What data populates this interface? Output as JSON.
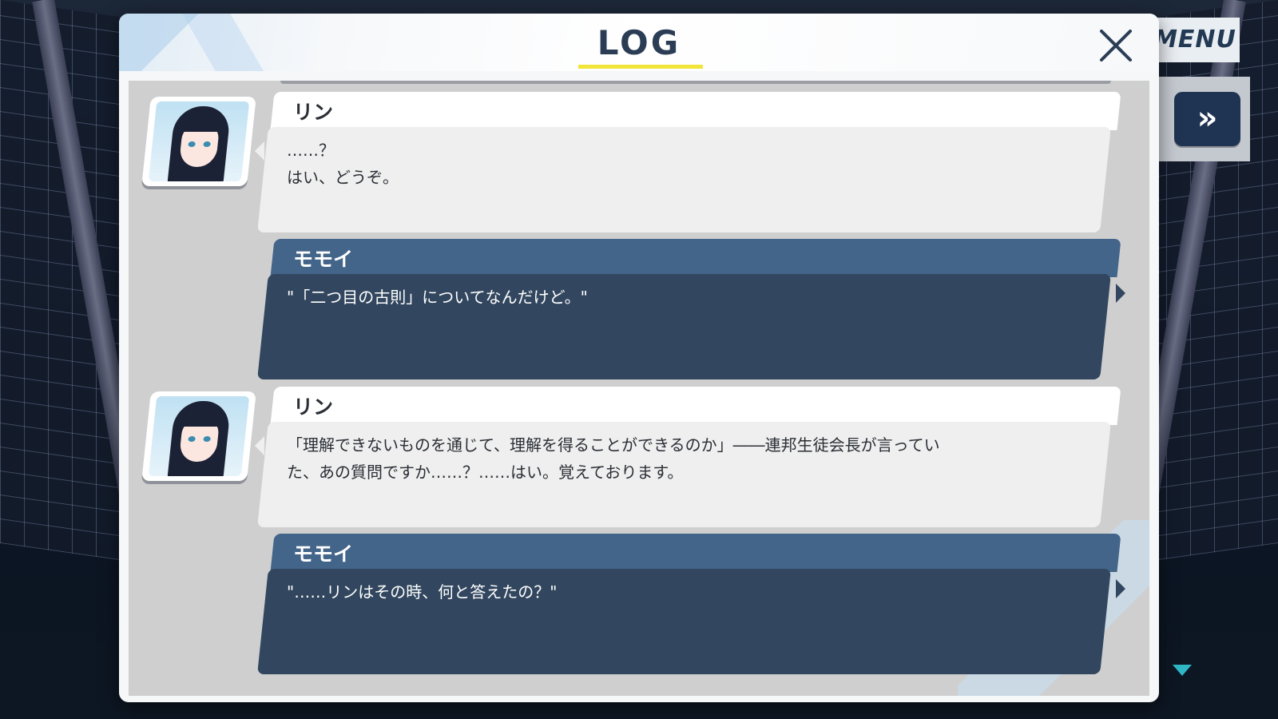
{
  "hud": {
    "menu_label": "MENU",
    "skip_label": "»"
  },
  "log": {
    "title": "LOG",
    "entries": [
      {
        "speaker": "リン",
        "style": "light",
        "has_avatar": true,
        "text": "……？\nはい、どうぞ。"
      },
      {
        "speaker": "モモイ",
        "style": "dark",
        "has_avatar": false,
        "text": "\"「二つ目の古則」についてなんだけど。\""
      },
      {
        "speaker": "リン",
        "style": "light",
        "has_avatar": true,
        "text": "「理解できないものを通じて、理解を得ることができるのか」――連邦生徒会長が言ってい\nた、あの質問ですか……？……はい。覚えております。"
      },
      {
        "speaker": "モモイ",
        "style": "dark",
        "has_avatar": false,
        "text": "\"……リンはその時、何と答えたの？\""
      }
    ]
  },
  "colors": {
    "accent_underline": "#f1e53a",
    "player_bar": "#43658a",
    "player_box": "#32475f",
    "npc_box": "#efefef",
    "scroll_arrow": "#2fb7c6"
  },
  "icons": {
    "close": "close-icon",
    "skip": "fast-forward-icon",
    "scroll": "scroll-down-icon"
  }
}
